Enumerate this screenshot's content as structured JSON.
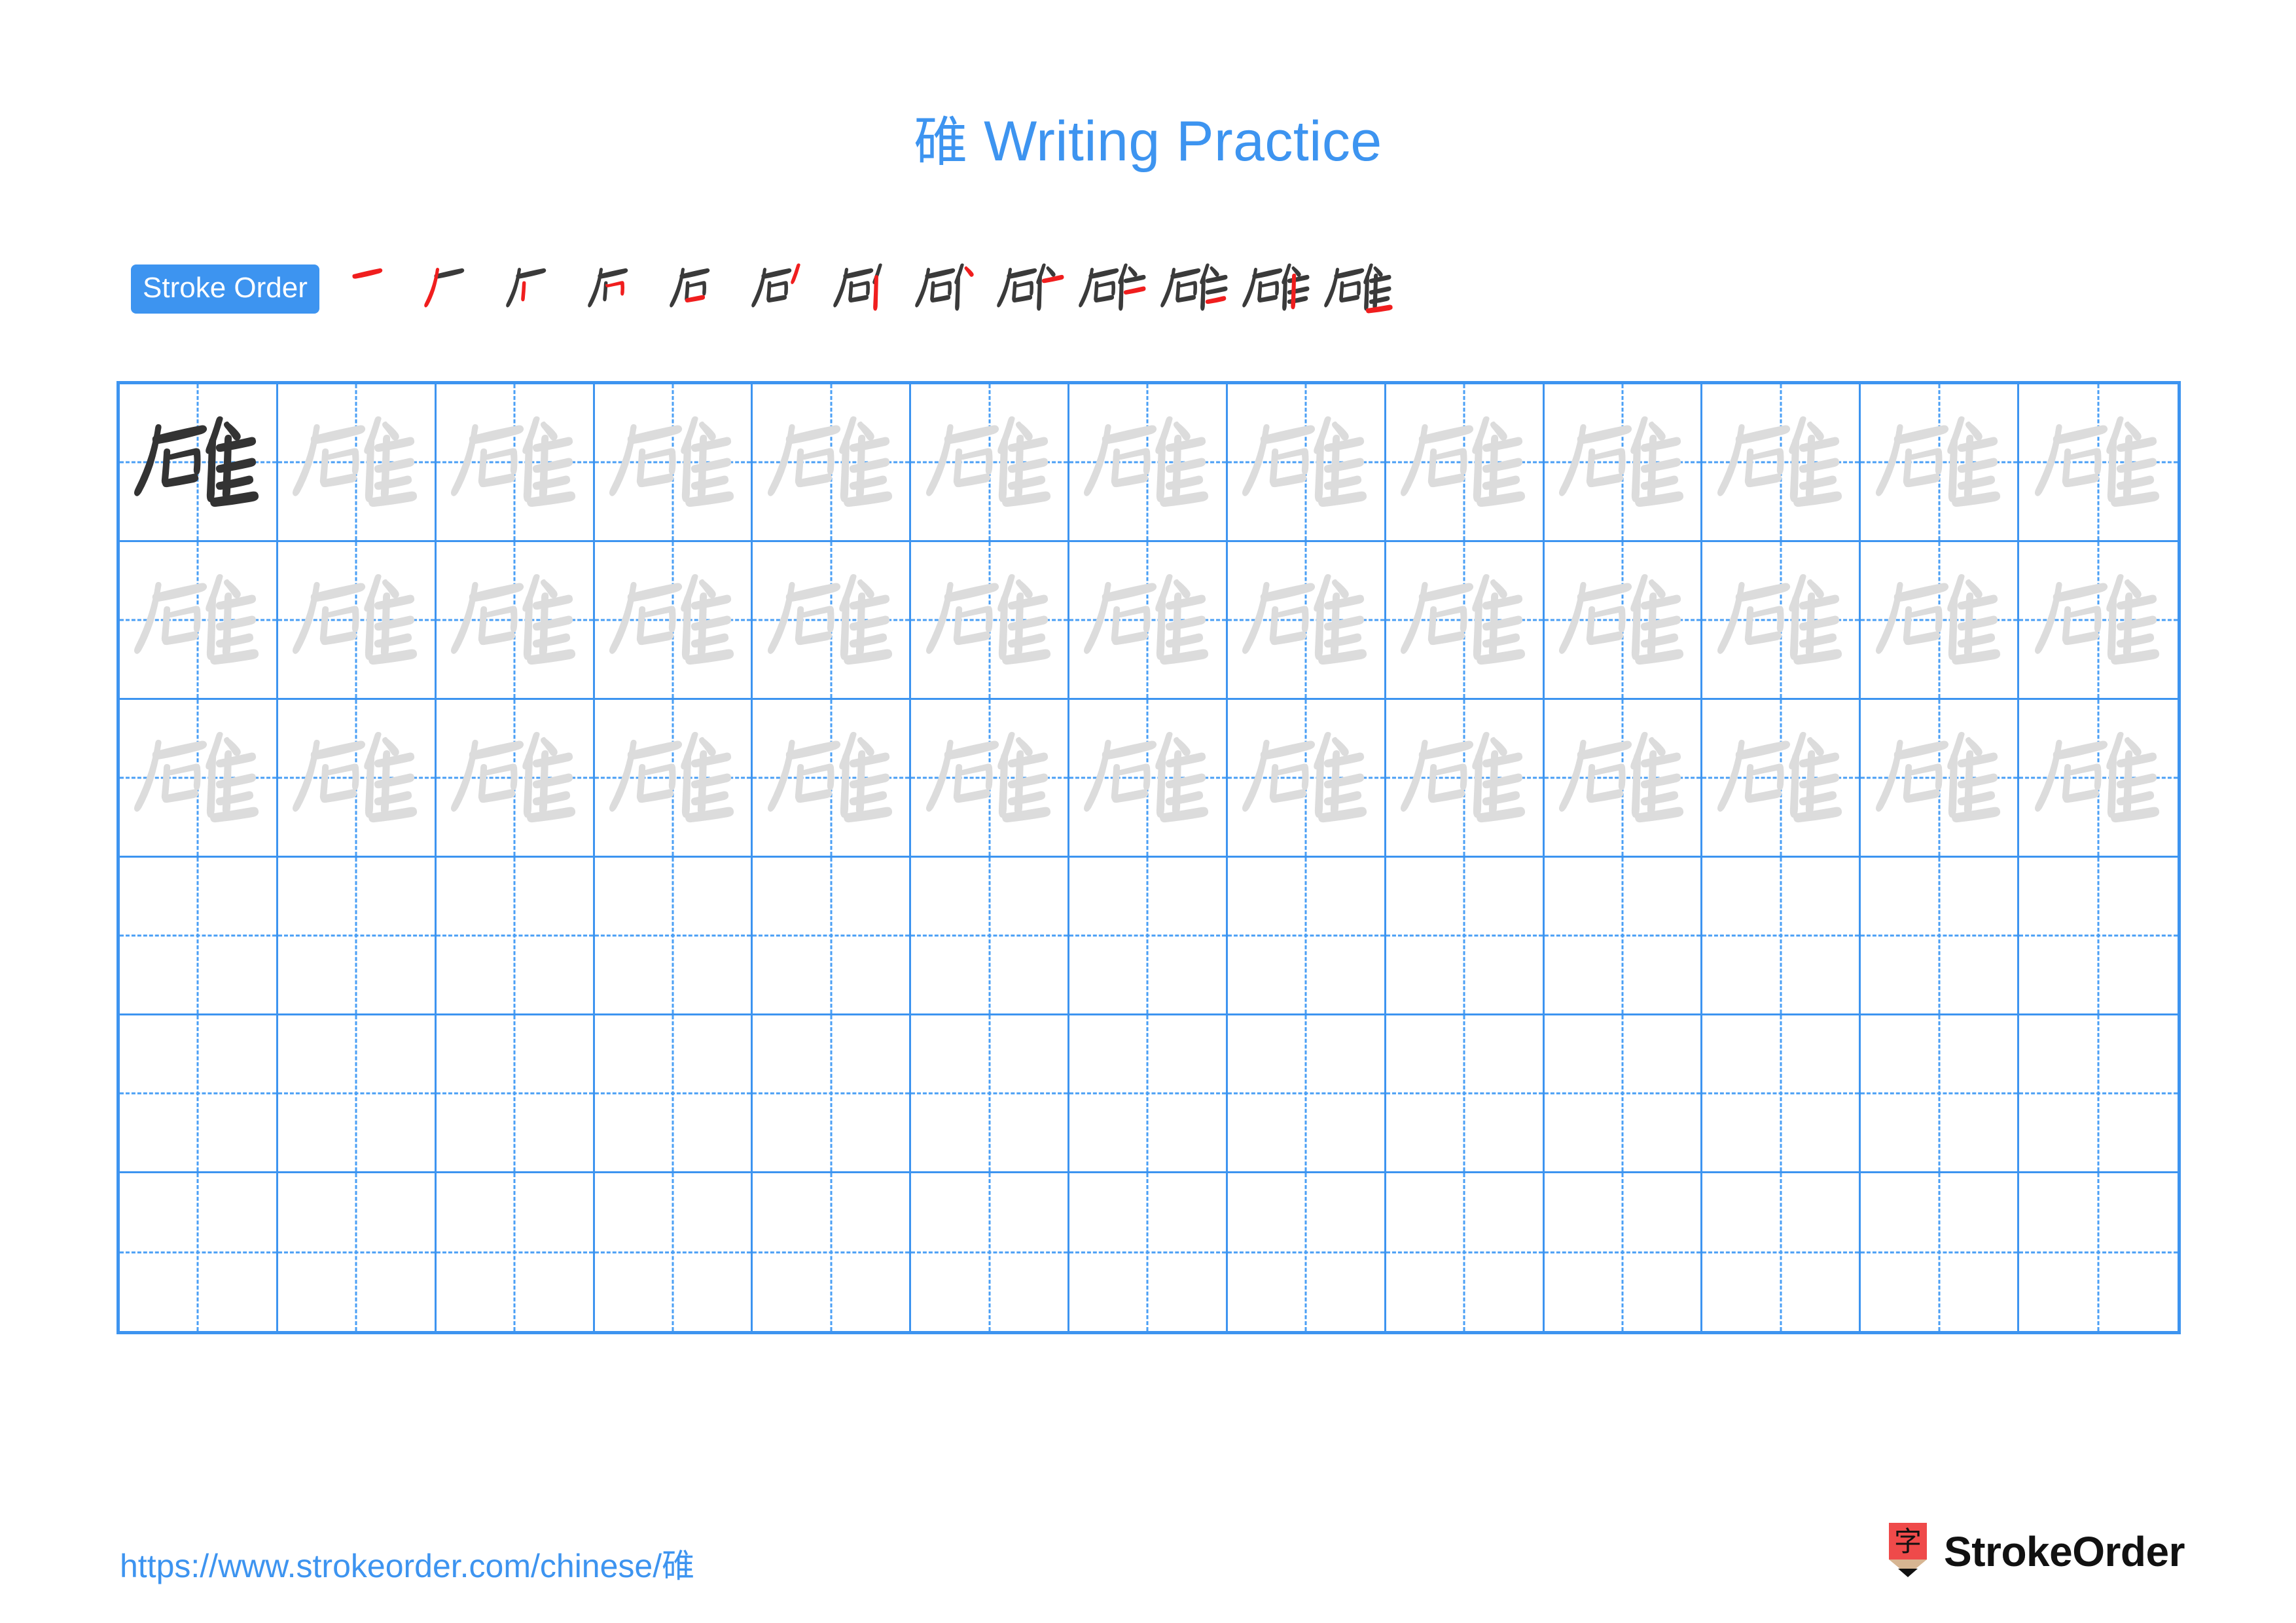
{
  "title": {
    "character": "碓",
    "text": "Writing Practice",
    "full": "碓 Writing Practice",
    "color": "#3d94f0"
  },
  "stroke_order": {
    "badge_label": "Stroke Order",
    "badge_bg": "#3d94f0",
    "badge_text_color": "#ffffff",
    "total_strokes": 13,
    "new_stroke_color": "#f01e1e",
    "previous_stroke_color": "#3a3a3a",
    "steps": [
      {
        "index": 1,
        "cumulative": "丿"
      },
      {
        "index": 2,
        "cumulative": "厂"
      },
      {
        "index": 3,
        "cumulative": "丆"
      },
      {
        "index": 4,
        "cumulative": "石"
      },
      {
        "index": 5,
        "cumulative": "石"
      },
      {
        "index": 6,
        "cumulative": "石丿"
      },
      {
        "index": 7,
        "cumulative": "矴"
      },
      {
        "index": 8,
        "cumulative": "矵"
      },
      {
        "index": 9,
        "cumulative": "矿"
      },
      {
        "index": 10,
        "cumulative": "硁"
      },
      {
        "index": 11,
        "cumulative": "硅"
      },
      {
        "index": 12,
        "cumulative": "碓"
      },
      {
        "index": 13,
        "cumulative": "碓"
      }
    ]
  },
  "practice_grid": {
    "columns": 13,
    "rows": 6,
    "grid_line_color": "#3d94f0",
    "guide_line_color": "#4a9ff5",
    "model_character": "碓",
    "model_color": "#333333",
    "trace_color": "#dcdcdc",
    "cells": [
      [
        "model",
        "trace",
        "trace",
        "trace",
        "trace",
        "trace",
        "trace",
        "trace",
        "trace",
        "trace",
        "trace",
        "trace",
        "trace"
      ],
      [
        "trace",
        "trace",
        "trace",
        "trace",
        "trace",
        "trace",
        "trace",
        "trace",
        "trace",
        "trace",
        "trace",
        "trace",
        "trace"
      ],
      [
        "trace",
        "trace",
        "trace",
        "trace",
        "trace",
        "trace",
        "trace",
        "trace",
        "trace",
        "trace",
        "trace",
        "trace",
        "trace"
      ],
      [
        "empty",
        "empty",
        "empty",
        "empty",
        "empty",
        "empty",
        "empty",
        "empty",
        "empty",
        "empty",
        "empty",
        "empty",
        "empty"
      ],
      [
        "empty",
        "empty",
        "empty",
        "empty",
        "empty",
        "empty",
        "empty",
        "empty",
        "empty",
        "empty",
        "empty",
        "empty",
        "empty"
      ],
      [
        "empty",
        "empty",
        "empty",
        "empty",
        "empty",
        "empty",
        "empty",
        "empty",
        "empty",
        "empty",
        "empty",
        "empty",
        "empty"
      ]
    ]
  },
  "footer": {
    "url": "https://www.strokeorder.com/chinese/碓",
    "url_color": "#3d94f0",
    "brand_name": "StrokeOrder",
    "brand_mark_character": "字",
    "brand_mark_bg": "#ef4a4a",
    "brand_mark_tip": "#d7b592"
  }
}
